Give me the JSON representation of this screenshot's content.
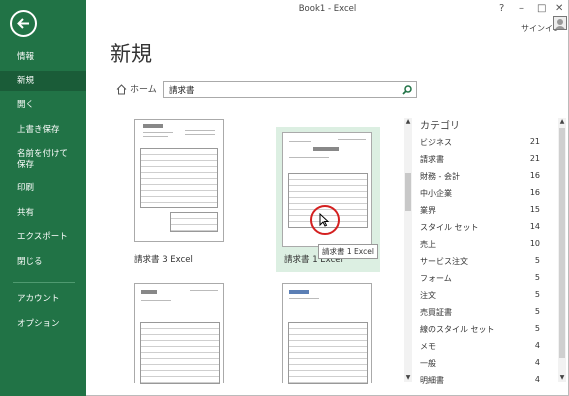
{
  "window": {
    "title": "Book1 - Excel",
    "help": "?",
    "minimize": "–",
    "restore": "□",
    "close": "✕"
  },
  "account": {
    "signin": "サインイン"
  },
  "sidebar": {
    "items": [
      {
        "label": "情報"
      },
      {
        "label": "新規"
      },
      {
        "label": "開く"
      },
      {
        "label": "上書き保存"
      },
      {
        "label": "名前を付けて\n保存"
      },
      {
        "label": "印刷"
      },
      {
        "label": "共有"
      },
      {
        "label": "エクスポート"
      },
      {
        "label": "閉じる"
      },
      {
        "label": "アカウント"
      },
      {
        "label": "オプション"
      }
    ]
  },
  "page": {
    "title": "新規"
  },
  "home": {
    "label": "ホーム"
  },
  "search": {
    "value": "請求書"
  },
  "templates": [
    {
      "name": "請求書 3 Excel"
    },
    {
      "name": "請求書 1 Excel"
    },
    {
      "name": ""
    },
    {
      "name": ""
    }
  ],
  "tooltip": "請求書 1 Excel",
  "category": {
    "title": "カテゴリ",
    "items": [
      {
        "name": "ビジネス",
        "count": "21"
      },
      {
        "name": "請求書",
        "count": "21"
      },
      {
        "name": "財務 - 会計",
        "count": "16"
      },
      {
        "name": "中小企業",
        "count": "16"
      },
      {
        "name": "業界",
        "count": "15"
      },
      {
        "name": "スタイル セット",
        "count": "14"
      },
      {
        "name": "売上",
        "count": "10"
      },
      {
        "name": "サービス注文",
        "count": "5"
      },
      {
        "name": "フォーム",
        "count": "5"
      },
      {
        "name": "注文",
        "count": "5"
      },
      {
        "name": "売買証書",
        "count": "5"
      },
      {
        "name": "線のスタイル セット",
        "count": "5"
      },
      {
        "name": "メモ",
        "count": "4"
      },
      {
        "name": "一般",
        "count": "4"
      },
      {
        "name": "明細書",
        "count": "4"
      }
    ]
  }
}
